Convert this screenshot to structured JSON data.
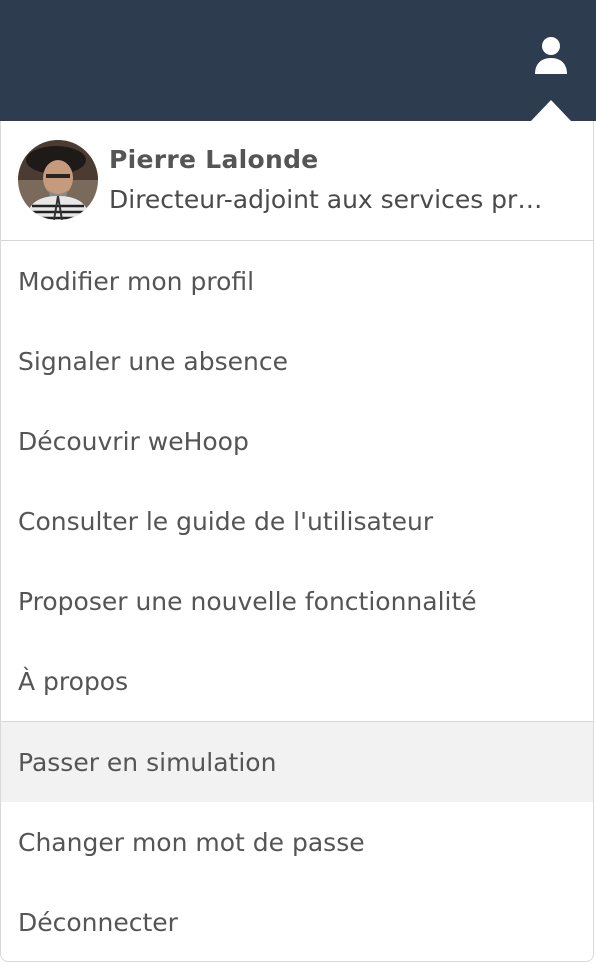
{
  "header": {
    "user_icon": "user-icon",
    "background_color": "#2e3c50"
  },
  "profile": {
    "name": "Pierre Lalonde",
    "role": "Directeur-adjoint aux services pr…"
  },
  "menu": {
    "primary_items": [
      {
        "label": "Modifier mon profil"
      },
      {
        "label": "Signaler une absence"
      },
      {
        "label": "Découvrir weHoop"
      },
      {
        "label": "Consulter le guide de l'utilisateur"
      },
      {
        "label": "Proposer une nouvelle fonctionnalité"
      },
      {
        "label": "À propos"
      }
    ],
    "secondary_items": [
      {
        "label": "Passer en simulation",
        "highlighted": true
      },
      {
        "label": "Changer mon mot de passe"
      },
      {
        "label": "Déconnecter"
      }
    ],
    "highlight_color": "#f2f2f2"
  }
}
